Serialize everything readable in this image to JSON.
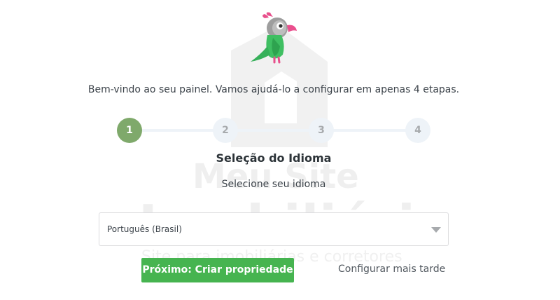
{
  "intro_text": "Bem-vindo ao seu painel. Vamos ajudá-lo a configurar em apenas 4 etapas.",
  "stepper": {
    "steps": [
      "1",
      "2",
      "3",
      "4"
    ],
    "active_step": 1
  },
  "section": {
    "title": "Seleção do Idioma",
    "subtitle": "Selecione seu idioma"
  },
  "language_select": {
    "value": "Português (Brasil)"
  },
  "actions": {
    "next_label": "Próximo: Criar propriedade",
    "later_label": "Configurar mais tarde"
  },
  "watermark": {
    "line1": "Meu Site",
    "line2": "Imobiliário",
    "line3": "Site para imobiliárias e corretores"
  },
  "icons": {
    "mascot": "parrot-mascot-icon",
    "dropdown": "chevron-down-icon"
  },
  "colors": {
    "active_step": "#7fa96b",
    "inactive_step": "#eef3f8",
    "primary_button": "#46b450"
  }
}
